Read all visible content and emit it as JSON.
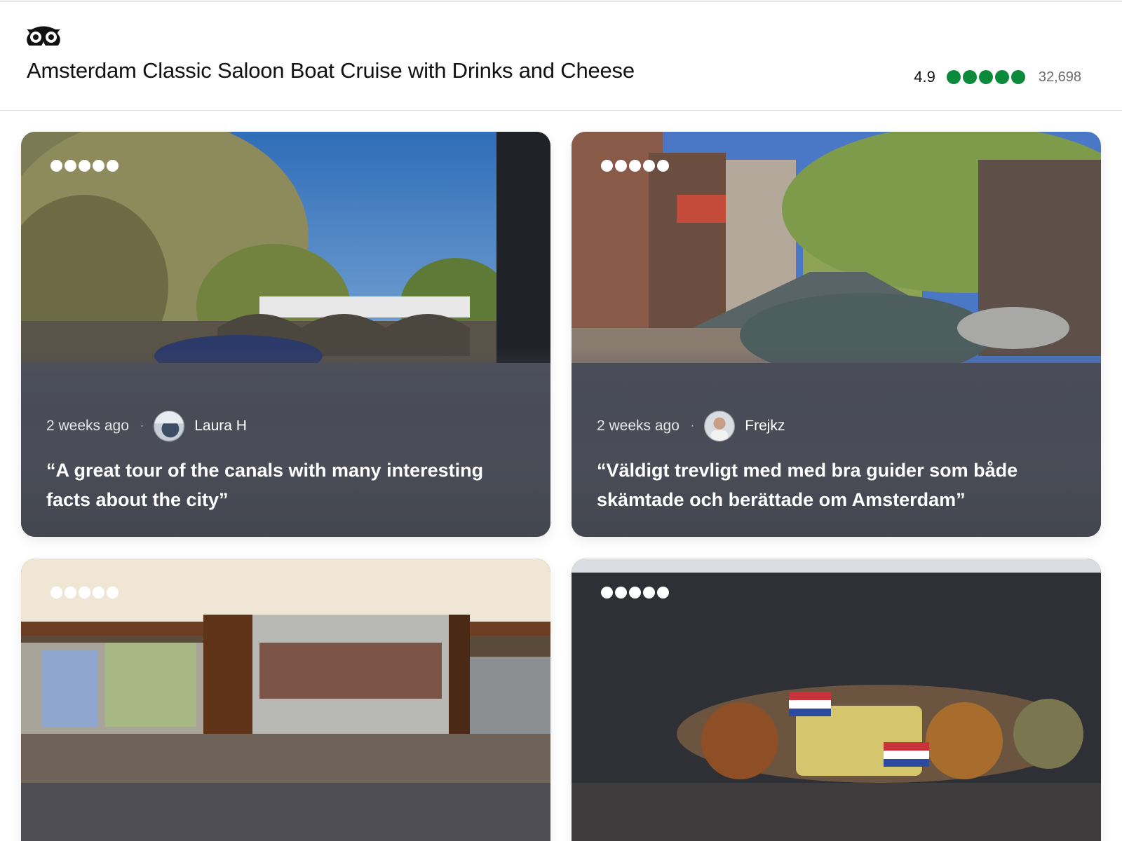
{
  "header": {
    "logo": "tripadvisor-owl-icon",
    "title": "Amsterdam Classic Saloon Boat Cruise with Drinks and Cheese",
    "rating_value": "4.9",
    "rating_bubbles": 5,
    "review_count": "32,698",
    "bubble_color": "#0b8a3c"
  },
  "reviews": [
    {
      "rating": 5,
      "time": "2 weeks ago",
      "separator": "·",
      "author": "Laura H",
      "quote": "“A great tour of the canals with many interesting facts about the city”",
      "photo_icon": "canal-bridge-photo"
    },
    {
      "rating": 5,
      "time": "2 weeks ago",
      "separator": "·",
      "author": "Frejkz",
      "quote": "“Väldigt trevligt med med bra guider som både skämtade och berättade om Amsterdam”",
      "photo_icon": "canal-street-photo"
    },
    {
      "rating": 5,
      "photo_icon": "boat-interior-photo"
    },
    {
      "rating": 5,
      "photo_icon": "cheese-plate-photo"
    }
  ]
}
